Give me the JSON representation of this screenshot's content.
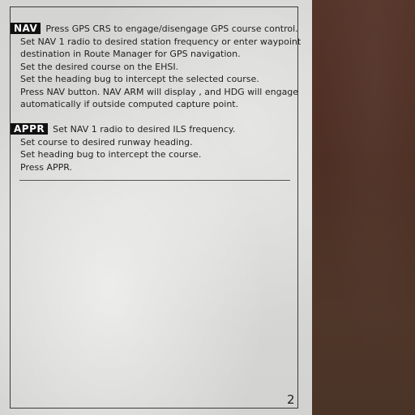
{
  "nav": {
    "badge": "NAV",
    "lines": [
      "Press GPS CRS to engage/disengage GPS course control.",
      "Set NAV 1 radio to desired station frequency or enter waypoint",
      "destination in Route Manager for GPS navigation.",
      "Set the desired course on the EHSI.",
      "Set the heading bug to intercept the selected course.",
      "Press NAV button. NAV ARM will display , and HDG will engage",
      "automatically if outside computed capture point."
    ]
  },
  "appr": {
    "badge": "APPR",
    "lines": [
      "Set NAV 1 radio to desired ILS frequency.",
      "Set course to desired runway heading.",
      "Set heading bug to intercept the course.",
      "Press APPR."
    ]
  },
  "page_number": "2",
  "colors": {
    "paper": "#d6d6d4",
    "badge_bg": "#111111",
    "wood": "#4e3026"
  }
}
